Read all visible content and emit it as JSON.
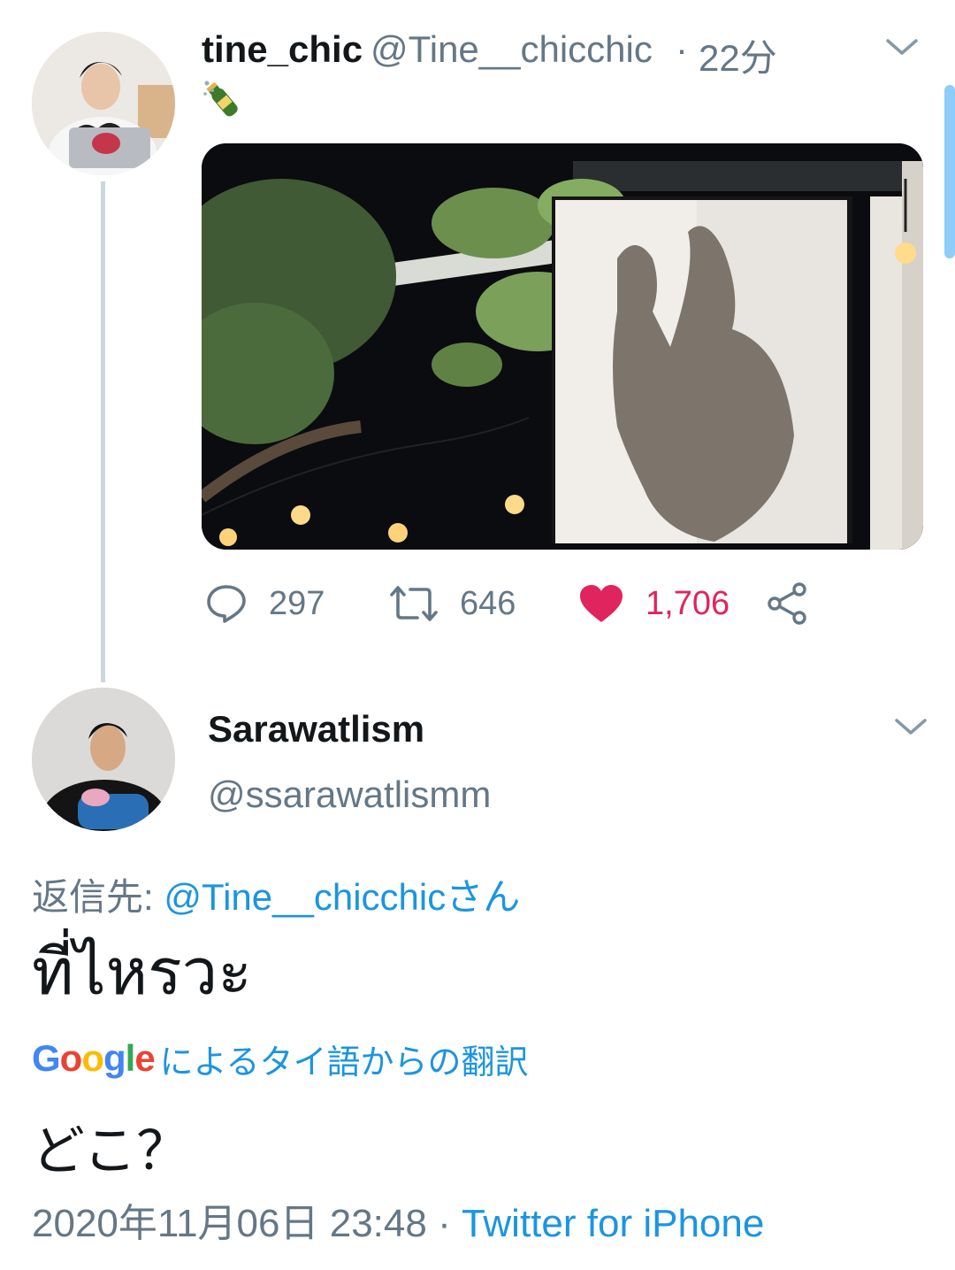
{
  "tweet": {
    "author_name": "tine_chic",
    "author_handle": "@Tine__chicchic",
    "separator": "·",
    "time": "22分",
    "emoji": "champagne-emoji",
    "actions": {
      "reply_count": "297",
      "retweet_count": "646",
      "like_count": "1,706"
    }
  },
  "reply": {
    "author_name": "Sarawatlism",
    "author_handle": "@ssarawatlismm",
    "reply_to_label": "返信先: ",
    "reply_to_handle": "@Tine__chicchicさん",
    "text": "ที่ไหรวะ",
    "translation_logo": "Google",
    "translation_label": "によるタイ語からの翻訳",
    "translated_text": "どこ？",
    "timestamp": "2020年11月06日 23:48",
    "footer_separator": " · ",
    "source": "Twitter for iPhone"
  },
  "colors": {
    "accent": "#1b95e0",
    "muted": "#657786",
    "like": "#e0245e",
    "thread_line": "#ccd6dd"
  }
}
